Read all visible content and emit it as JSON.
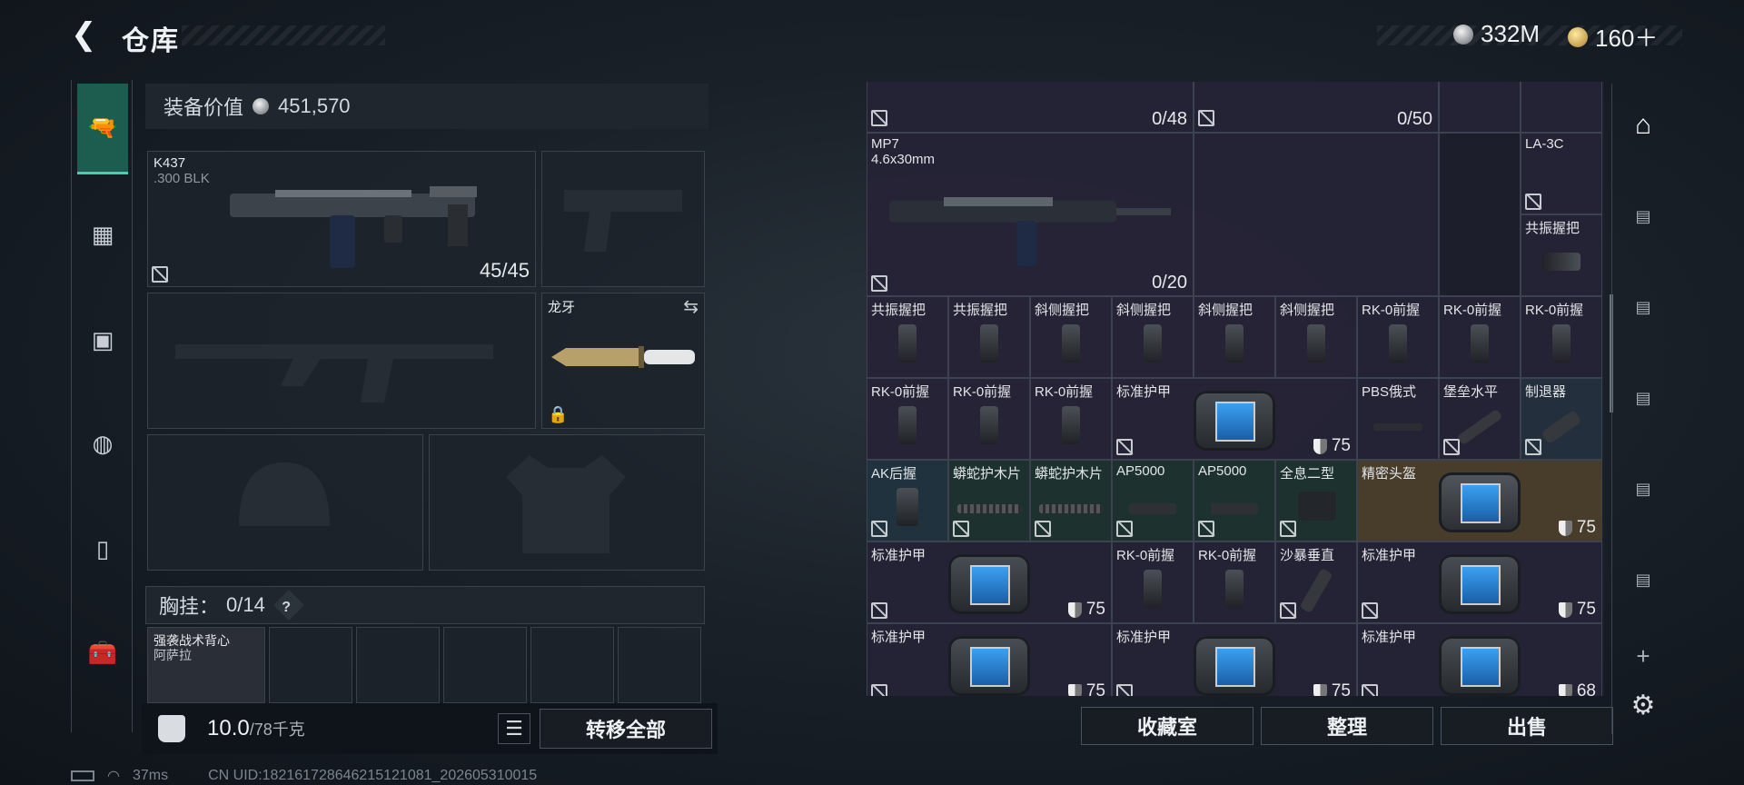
{
  "header": {
    "title": "仓库",
    "currency_silver": "332M",
    "currency_gold": "160＋"
  },
  "loadout": {
    "equipment_value_label": "装备价值",
    "equipment_value": "451,570",
    "primary": {
      "name": "K437",
      "ammo_type": ".300 BLK",
      "ammo": "45/45"
    },
    "melee": {
      "name": "龙牙"
    },
    "chest_label": "胸挂：",
    "chest_count": "0/14",
    "help_glyph": "?",
    "vest_item": "强袭战术背心",
    "vest_item_sub": "阿萨拉",
    "weight": "10.0",
    "weight_max": "/78千克",
    "transfer_all": "转移全部"
  },
  "storage": {
    "top_left_count": "0/48",
    "top_right_count": "0/50",
    "mp7": {
      "name": "MP7",
      "ammo": "4.6x30mm",
      "count": "0/20"
    },
    "la3c": "LA-3C",
    "resonance_grip_side": "共振握把",
    "row1": [
      "共振握把",
      "共振握把",
      "斜侧握把",
      "斜侧握把",
      "斜侧握把",
      "斜侧握把",
      "RK-0前握",
      "RK-0前握",
      "RK-0前握"
    ],
    "row2": [
      "RK-0前握",
      "RK-0前握",
      "RK-0前握"
    ],
    "armor_std": "标准护甲",
    "armor_val": "75",
    "armor_val_faded": "68",
    "pbs": "PBS俄式",
    "fort": "堡垒水平",
    "brake": "制退器",
    "row3": [
      "AK后握",
      "蟒蛇护木片",
      "蟒蛇护木片",
      "AP5000",
      "AP5000",
      "全息二型"
    ],
    "helmet": "精密头盔",
    "row4_rk": [
      "RK-0前握",
      "RK-0前握"
    ],
    "sand": "沙暴垂直"
  },
  "actions": {
    "collection": "收藏室",
    "sort": "整理",
    "sell": "出售"
  },
  "status": {
    "ping": "37ms",
    "uid": "CN UID:1821617286462151​21081_202605310015"
  },
  "colors": {
    "accent": "#3fd3b0",
    "nav_active": "#1c5d4f",
    "cell": "#26243a",
    "cell_gold": "#4a3f2a"
  }
}
